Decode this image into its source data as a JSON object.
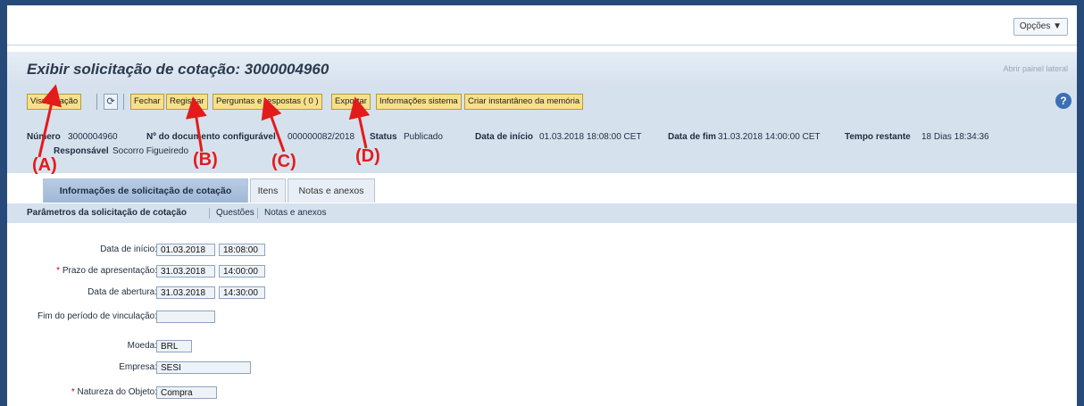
{
  "topbar": {
    "options_label": "Opções ▼"
  },
  "header": {
    "title": "Exibir solicitação de cotação: 3000004960",
    "side_panel_link": "Abrir painel lateral"
  },
  "toolbar": {
    "visualizacao": "Visualização",
    "fechar": "Fechar",
    "registrar": "Registrar",
    "perguntas": "Perguntas e respostas ( 0 )",
    "exportar": "Exportar",
    "info_sistema": "Informações sistema",
    "instantaneo": "Criar instantâneo da memória",
    "refresh_icon": "refresh-icon",
    "help_icon": "help-icon"
  },
  "info": {
    "numero_label": "Número",
    "numero_value": "3000004960",
    "doc_label": "Nº do documento configurável",
    "doc_value": "000000082/2018",
    "status_label": "Status",
    "status_value": "Publicado",
    "inicio_label": "Data de início",
    "inicio_value": "01.03.2018 18:08:00 CET",
    "fim_label": "Data de fim",
    "fim_value": "31.03.2018 14:00:00 CET",
    "tempo_label": "Tempo restante",
    "tempo_value": "18 Dias 18:34:36",
    "resp_label": "Responsável",
    "resp_value": "Socorro Figueiredo"
  },
  "tabs": [
    {
      "label": "Informações de solicitação de cotação",
      "active": true
    },
    {
      "label": "Itens",
      "active": false
    },
    {
      "label": "Notas e anexos",
      "active": false
    }
  ],
  "subnav": [
    "Parâmetros da solicitação de cotação",
    "Questões",
    "Notas e anexos"
  ],
  "form": {
    "data_inicio": {
      "label": "Data de início:",
      "date": "01.03.2018",
      "time": "18:08:00"
    },
    "prazo": {
      "label": "Prazo de apresentação:",
      "date": "31.03.2018",
      "time": "14:00:00",
      "required": "*"
    },
    "abertura": {
      "label": "Data de abertura:",
      "date": "31.03.2018",
      "time": "14:30:00"
    },
    "vinculacao": {
      "label": "Fim do período de vinculação:",
      "value": ""
    },
    "moeda": {
      "label": "Moeda:",
      "value": "BRL"
    },
    "empresa": {
      "label": "Empresa:",
      "value": "SESI"
    },
    "natureza": {
      "label": "Natureza do Objeto:",
      "value": "Compra",
      "required": "*"
    }
  },
  "annotations": {
    "a": "(A)",
    "b": "(B)",
    "c": "(C)",
    "d": "(D)"
  },
  "colors": {
    "annotation": "#e41b1b",
    "button_bg": "#f7e08a",
    "frame": "#264a7a"
  }
}
